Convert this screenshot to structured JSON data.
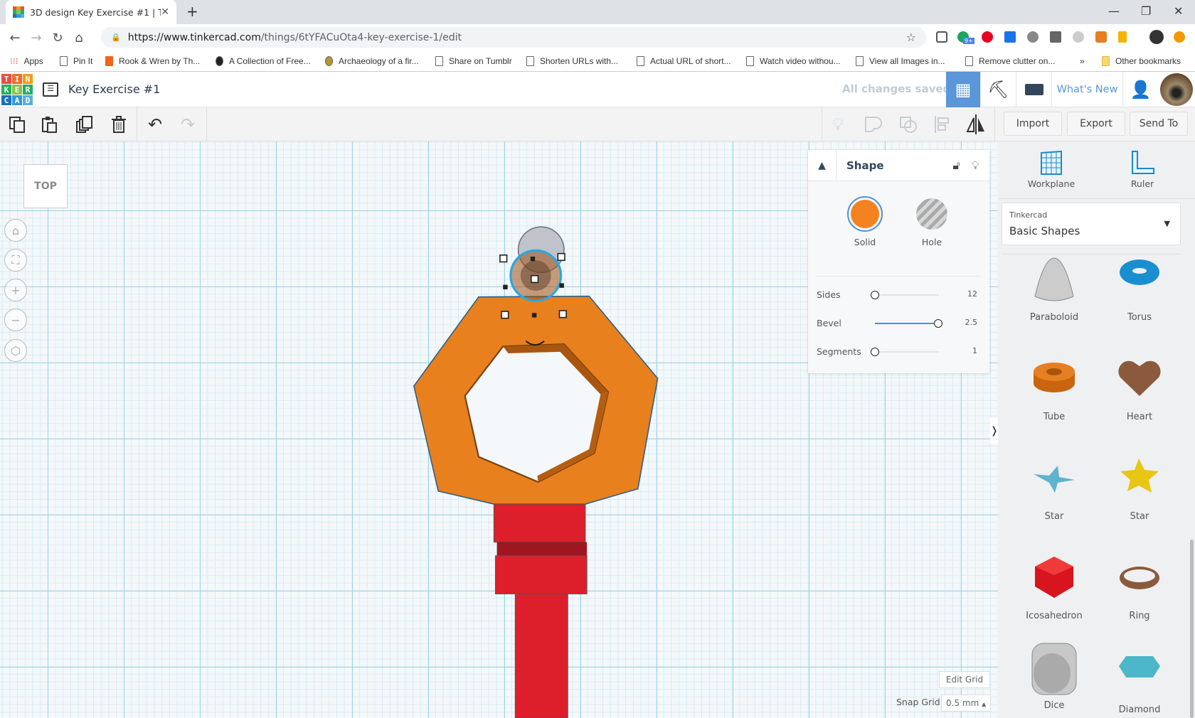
{
  "browser": {
    "tab_title": "3D design Key Exercise #1 | Tinkercad",
    "new_tab": "+",
    "url_host": "https://www.tinkercad.com",
    "url_path": "/things/6tYFACuOta4-key-exercise-1/edit",
    "bookmarks": [
      "Apps",
      "Pin It",
      "Rook & Wren by Th...",
      "A Collection of Free...",
      "Archaeology of a fir...",
      "Share on Tumblr",
      "Shorten URLs with...",
      "Actual URL of short...",
      "Watch video withou...",
      "View all Images in...",
      "Remove clutter on..."
    ],
    "more_bookmarks": "»",
    "other_bookmarks": "Other bookmarks",
    "extension_badge": "9+"
  },
  "app": {
    "logo_letters": [
      "T",
      "I",
      "N",
      "K",
      "E",
      "R",
      "C",
      "A",
      "D"
    ],
    "design_title": "Key Exercise #1",
    "save_status": "All changes saved",
    "whats_new": "What's New",
    "toolbar": {
      "import": "Import",
      "export": "Export",
      "send_to": "Send To"
    },
    "view_cube": "TOP"
  },
  "shape_panel": {
    "title": "Shape",
    "solid": "Solid",
    "hole": "Hole",
    "params": [
      {
        "label": "Sides",
        "value": "12",
        "fraction": 0
      },
      {
        "label": "Bevel",
        "value": "2.5",
        "fraction": 1
      },
      {
        "label": "Segments",
        "value": "1",
        "fraction": 0
      }
    ],
    "solid_color": "#f5821f"
  },
  "right_panel": {
    "workplane": "Workplane",
    "ruler": "Ruler",
    "library_source": "Tinkercad",
    "library_name": "Basic Shapes",
    "shapes": [
      "Paraboloid",
      "Torus",
      "Tube",
      "Heart",
      "Star",
      "Star",
      "Icosahedron",
      "Ring",
      "Dice",
      "Diamond"
    ]
  },
  "grid": {
    "edit_grid": "Edit Grid",
    "snap_label": "Snap Grid",
    "snap_value": "0.5 mm"
  },
  "colors": {
    "accent": "#5b96d9",
    "orange": "#e8801e",
    "red": "#dd1f2c"
  }
}
